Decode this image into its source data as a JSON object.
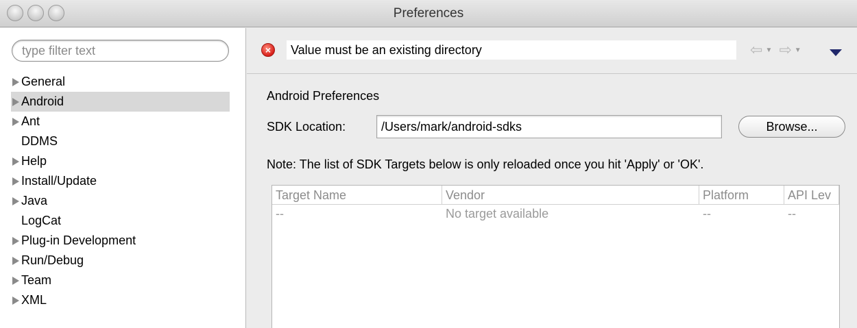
{
  "window": {
    "title": "Preferences"
  },
  "filter": {
    "placeholder": "type filter text"
  },
  "tree": {
    "items": [
      {
        "label": "General",
        "expandable": true
      },
      {
        "label": "Android",
        "expandable": true,
        "selected": true
      },
      {
        "label": "Ant",
        "expandable": true
      },
      {
        "label": "DDMS",
        "expandable": false
      },
      {
        "label": "Help",
        "expandable": true
      },
      {
        "label": "Install/Update",
        "expandable": true
      },
      {
        "label": "Java",
        "expandable": true
      },
      {
        "label": "LogCat",
        "expandable": false
      },
      {
        "label": "Plug-in Development",
        "expandable": true
      },
      {
        "label": "Run/Debug",
        "expandable": true
      },
      {
        "label": "Team",
        "expandable": true
      },
      {
        "label": "XML",
        "expandable": true
      }
    ]
  },
  "message": {
    "text": "Value must be an existing directory",
    "icon": "error-icon"
  },
  "nav": {
    "back_icon": "back-arrow-icon",
    "forward_icon": "forward-arrow-icon",
    "menu_icon": "view-menu-icon"
  },
  "page": {
    "title": "Android Preferences",
    "sdk_label": "SDK Location:",
    "sdk_value": "/Users/mark/android-sdks",
    "browse_label": "Browse...",
    "note": "Note: The list of SDK Targets below is only reloaded once you hit 'Apply' or 'OK'."
  },
  "table": {
    "columns": [
      "Target Name",
      "Vendor",
      "Platform",
      "API Lev"
    ],
    "rows": [
      [
        "--",
        "No target available",
        "--",
        "--"
      ]
    ]
  }
}
